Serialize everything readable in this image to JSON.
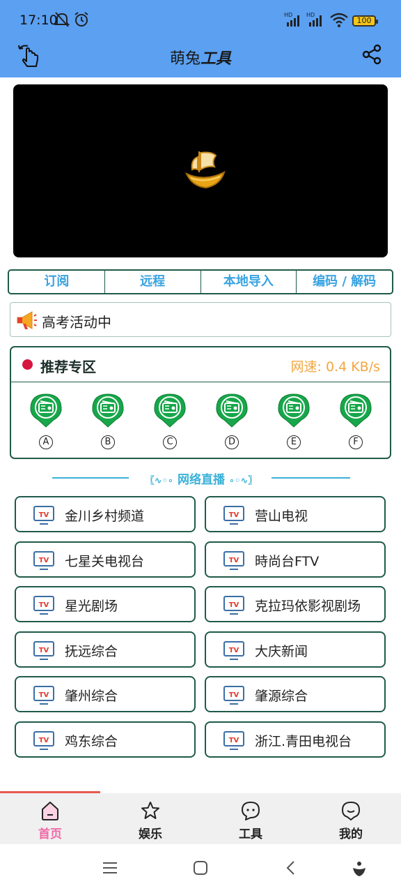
{
  "status_bar": {
    "time": "17:10",
    "battery": "100",
    "icons": [
      "mute-icon",
      "alarm-icon",
      "signal-hd-icon",
      "signal-hd-icon",
      "wifi-icon",
      "battery-icon"
    ]
  },
  "app_bar": {
    "title_plain": "萌兔",
    "title_bold": "工具",
    "back_icon": "back-hand-icon",
    "share_icon": "share-icon"
  },
  "player": {
    "logo_icon": "golden-ship-icon"
  },
  "tabs": [
    "订阅",
    "远程",
    "本地导入",
    "编码 / 解码"
  ],
  "notice": {
    "text": "高考活动中",
    "icon": "megaphone-icon"
  },
  "recommend": {
    "title": "推荐专区",
    "speed": "网速: 0.4 KB/s",
    "radios": [
      "A",
      "B",
      "C",
      "D",
      "E",
      "F"
    ]
  },
  "live_section": {
    "title": "网络直播"
  },
  "channels": [
    "金川乡村频道",
    "营山电视",
    "七星关电视台",
    "時尚台FTV",
    "星光剧场",
    "克拉玛依影视剧场",
    "抚远综合",
    "大庆新闻",
    "肇州综合",
    "肇源综合",
    "鸡东综合",
    "浙江.青田电视台"
  ],
  "bottom_nav": [
    {
      "label": "首页",
      "icon": "home-icon",
      "active": true
    },
    {
      "label": "娱乐",
      "icon": "star-icon",
      "active": false
    },
    {
      "label": "工具",
      "icon": "chat-bubble-icon",
      "active": false
    },
    {
      "label": "我的",
      "icon": "profile-bubble-icon",
      "active": false
    }
  ],
  "colors": {
    "header_blue": "#5ba0f1",
    "border_green": "#1f5a4a",
    "tab_text_blue": "#3aa3e0",
    "speed_orange": "#f2a640",
    "radio_green": "#17a74a",
    "active_pink": "#f06aa8",
    "dot_red": "#d6163f"
  }
}
